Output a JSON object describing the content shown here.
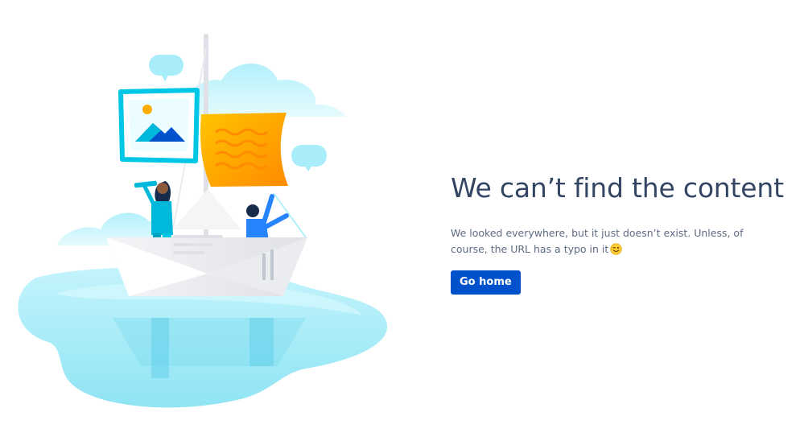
{
  "error": {
    "title": "We can’t find the content",
    "message": "We looked everywhere, but it just doesn’t exist. Unless, of course, the URL has a typo in it",
    "emoji_icon": "winking-face-icon",
    "button_label": "Go home"
  },
  "colors": {
    "title": "#344563",
    "body_text": "#5e6c84",
    "button_bg": "#0052cc",
    "button_text": "#ffffff",
    "water": "#a4ecf8",
    "sail": "#ffab00"
  }
}
